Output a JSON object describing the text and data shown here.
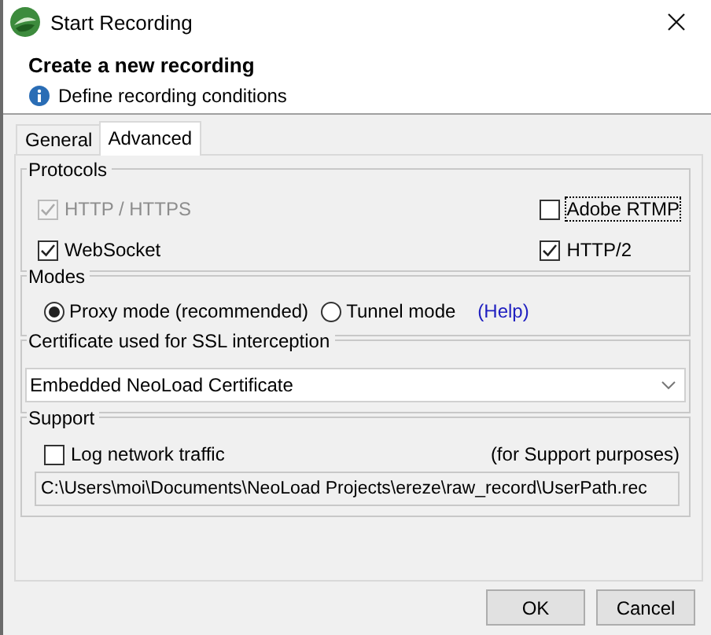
{
  "window": {
    "title": "Start Recording"
  },
  "header": {
    "title": "Create a new recording",
    "info": "Define recording conditions"
  },
  "tabs": [
    {
      "label": "General",
      "selected": false
    },
    {
      "label": "Advanced",
      "selected": true
    }
  ],
  "protocols": {
    "title": "Protocols",
    "items": [
      {
        "label": "HTTP / HTTPS",
        "checked": true,
        "disabled": true,
        "focused": false
      },
      {
        "label": "Adobe RTMP",
        "checked": false,
        "disabled": false,
        "focused": true
      },
      {
        "label": "WebSocket",
        "checked": true,
        "disabled": false,
        "focused": false
      },
      {
        "label": "HTTP/2",
        "checked": true,
        "disabled": false,
        "focused": false
      }
    ]
  },
  "modes": {
    "title": "Modes",
    "options": [
      {
        "label": "Proxy mode (recommended)",
        "selected": true
      },
      {
        "label": "Tunnel mode",
        "selected": false
      }
    ],
    "help_link": "(Help)"
  },
  "certificate": {
    "title": "Certificate used for SSL interception",
    "value": "Embedded NeoLoad Certificate"
  },
  "support": {
    "title": "Support",
    "log_label": "Log network traffic",
    "log_checked": false,
    "note": "(for Support purposes)",
    "path": "C:\\Users\\moi\\Documents\\NeoLoad Projects\\ereze\\raw_record\\UserPath.rec"
  },
  "buttons": [
    "OK",
    "Cancel"
  ]
}
